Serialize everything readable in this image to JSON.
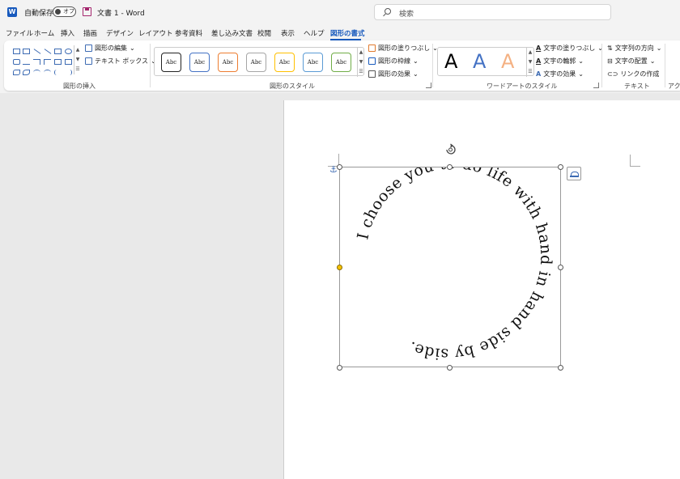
{
  "titlebar": {
    "app_icon": "word-icon",
    "autosave_label": "自動保存",
    "autosave_state": "オフ",
    "save_icon": "save-icon",
    "document_title": "文書 1  -  Word",
    "search_placeholder": "検索"
  },
  "menu": {
    "items": [
      "ファイル",
      "ホーム",
      "挿入",
      "描画",
      "デザイン",
      "レイアウト",
      "参考資料",
      "差し込み文書",
      "校閲",
      "表示",
      "ヘルプ",
      "図形の書式"
    ],
    "active": "図形の書式"
  },
  "ribbon": {
    "insert_shapes": {
      "label": "図形の挿入",
      "edit_shape": "図形の編集",
      "text_box": "テキスト ボックス"
    },
    "shape_styles": {
      "label": "図形のスタイル",
      "swatches": [
        {
          "text": "Abc",
          "color": "#222222"
        },
        {
          "text": "Abc",
          "color": "#4472c4"
        },
        {
          "text": "Abc",
          "color": "#ed7d31"
        },
        {
          "text": "Abc",
          "color": "#a5a5a5"
        },
        {
          "text": "Abc",
          "color": "#ffc000"
        },
        {
          "text": "Abc",
          "color": "#5b9bd5"
        },
        {
          "text": "Abc",
          "color": "#70ad47"
        }
      ],
      "fill": "図形の塗りつぶし",
      "outline": "図形の枠線",
      "effects": "図形の効果"
    },
    "wordart": {
      "label": "ワードアートのスタイル",
      "samples": [
        {
          "text": "A",
          "color": "#000000"
        },
        {
          "text": "A",
          "color": "#4472c4"
        },
        {
          "text": "A",
          "color": "#f4b183"
        }
      ],
      "text_fill": "文字の塗りつぶし",
      "text_outline": "文字の輪郭",
      "text_effects": "文字の効果"
    },
    "text": {
      "label": "テキスト",
      "direction": "文字列の方向",
      "align": "文字の配置",
      "link": "リンクの作成"
    },
    "accessibility_label": "アクセ"
  },
  "document": {
    "wordart_text": "I choose you to do life with hand in hand side by side."
  }
}
